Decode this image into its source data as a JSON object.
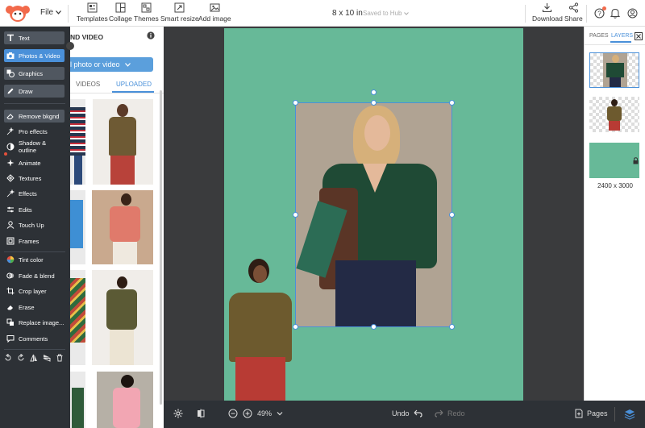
{
  "app": {
    "file_menu": "File",
    "doc_size": "8 x 10 in",
    "saved_status": "Saved to Hub"
  },
  "toolbar": {
    "templates": "Templates",
    "collage": "Collage",
    "themes": "Themes",
    "smart_resize": "Smart resize",
    "add_image": "Add image",
    "download": "Download",
    "share": "Share"
  },
  "rail": {
    "text": "Text",
    "photos_video": "Photos & Video",
    "graphics": "Graphics",
    "draw": "Draw",
    "remove_bkgnd": "Remove bkgnd",
    "pro_effects": "Pro effects",
    "shadow_outline": "Shadow & outline",
    "animate": "Animate",
    "textures": "Textures",
    "effects": "Effects",
    "edits": "Edits",
    "touch_up": "Touch Up",
    "frames": "Frames",
    "tint_color": "Tint color",
    "fade_blend": "Fade & blend",
    "crop_layer": "Crop layer",
    "erase": "Erase",
    "replace_image": "Replace image...",
    "comments": "Comments"
  },
  "panel": {
    "title": "ND VIDEO",
    "upload_button": "l photo or video",
    "tabs": {
      "videos": "VIDEOS",
      "uploaded": "UPLOADED"
    }
  },
  "bottombar": {
    "zoom": "49%",
    "undo": "Undo",
    "redo": "Redo",
    "pages": "Pages"
  },
  "layers_panel": {
    "tab_pages": "PAGES",
    "tab_layers": "LAYERS",
    "background_size": "2400 x 3000"
  },
  "colors": {
    "accent": "#4a90d9",
    "artboard": "#67b998",
    "rail_bg": "#2d3136",
    "canvas_bg": "#3a3b3d"
  }
}
